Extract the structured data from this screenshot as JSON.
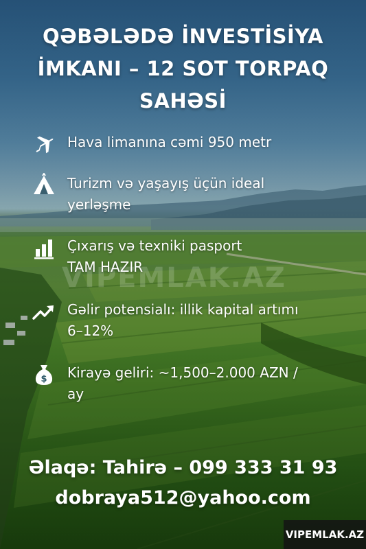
{
  "title": {
    "line1": "QƏBƏLƏDƏ İNVESTİSİYA",
    "line2": "İMKANI – 12 SOT TORPAQ",
    "line3": "SAHƏSİ"
  },
  "features": [
    {
      "icon": "airplane-icon",
      "line1": "Hava limanına cəmi 950 metr",
      "line2": ""
    },
    {
      "icon": "tent-icon",
      "line1": "Turizm və yaşayış üçün ideal",
      "line2": "yerləşme"
    },
    {
      "icon": "bar-chart-icon",
      "line1": "Çıxarış və texniki pasport",
      "line2": "TAM HAZIR"
    },
    {
      "icon": "trend-up-icon",
      "line1": "Gəlir potensialı: illik kapital artımı",
      "line2": "6–12%"
    },
    {
      "icon": "money-bag-icon",
      "line1": "Kirayə geliri: ~1,500–2.000 AZN /",
      "line2": "ay"
    }
  ],
  "contact": {
    "phone_line": "Əlaqə: Tahirə – 099 333 31 93",
    "email": "dobraya512@yahoo.com"
  },
  "watermark": "VIPEMLAK.AZ",
  "badge": "VIPEMLAK.AZ"
}
